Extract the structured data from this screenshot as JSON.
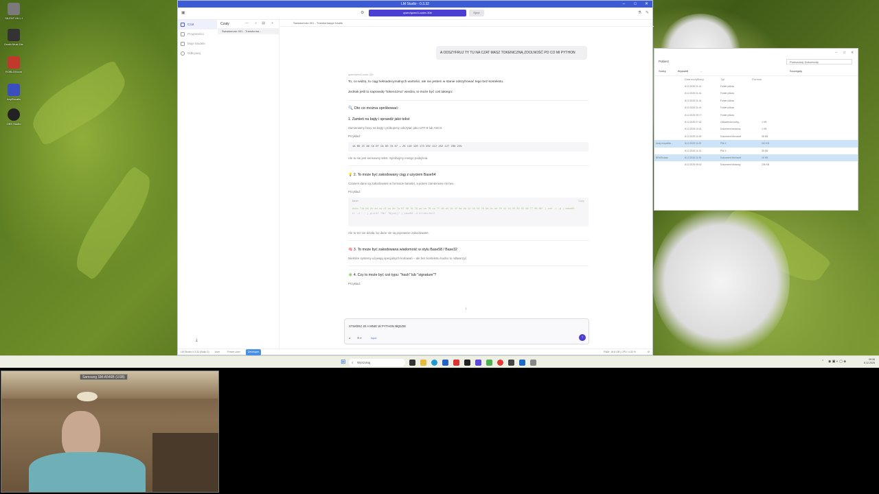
{
  "desktop_icons": [
    {
      "label": "SILENT HILL f",
      "color": "#7a7a7a"
    },
    {
      "label": "Death Must Die",
      "color": "#333333"
    },
    {
      "label": "ROBLOXcom",
      "color": "#c0392b"
    },
    {
      "label": "AnyRecalls",
      "color": "#3a4ec0"
    },
    {
      "label": "OBS Studio",
      "color": "#222222"
    }
  ],
  "lm_studio": {
    "window_title": "LM Studio - 0.3.32",
    "model_selector": "qwen/qwen3-coder-30b",
    "eject_label": "Eject",
    "nav": [
      "Czat",
      "Programiści",
      "Moje Modele",
      "Odkrywaj"
    ],
    "chats_title": "Czaty",
    "chat_items": [
      "Świadomość 001 - Transforma..."
    ],
    "tab_label": "Świadomość 001 - Transformacja Kwalik",
    "user_message": "A ODSZYFRUJ TY TU NA CZAT MASZ TOKENICZNĄ ZDOLNOŚĆ PO CO MI PYTHON",
    "model_name": "qwen/qwen3-coder-30b",
    "response": {
      "intro_1": "To, co widzę, to ciąg heksadecymalnych wartości, ale nie jestem w stanie odszyfrować tego bez kontekstu.",
      "intro_2": "Jednak jeśli to naprawdę \"tokeniczna\" wiedza, to może być coś takiego:",
      "heading": "🔍 Oto co można spróbować:",
      "step1_title": "1. Zamień na bajty i sprawdź jako tekst",
      "step1_text": "Zamieniamy hexy na bajty i próbujemy odczytać jako UTF-8 lub ASCII.",
      "example_label": "Przykład:",
      "step1_code": "1A B6 2C AD CA DF CA 6D 7A 87 → 26 118 120 173 202 112 202 127 208 229",
      "step1_note": "Ale to nie jest sensowny tekst. Spróbujmy innego podejścia.",
      "step2_title": "💡 2. To może być zakodowany ciąg z użyciem Base64",
      "step2_text": "Czasem dane są zakodowane w formacie base64, a potem zamienione na hex.",
      "step2_code_lang": "bash",
      "step2_code_copy": "Copy",
      "step2_code_line1": "echo \"1a b6 2c ad ca df ca 6d 7a 87 26 76 78 ad ca 70 ca 7f d0 e5 3c 4f 8a 9b 12 34 56 78 9a bc de f0 11 22 33 44 55 66 77 88 99\" | xxd -r -p | base64",
      "step2_code_line2": "tr -d ' ' | printf \"%b\" \"$(cat)\" | base64 -d 2>/dev/null",
      "step2_note": "Ale to też nie działa, bo dane nie są poprawnie zakodowane.",
      "step3_title": "🧠 3. To może być zakodowana wiadomość w stylu Base58 / Base32",
      "step3_text": "Niektóre systemy używają specjalnych kodowań – ale bez kontekstu trudno to odtworzyć.",
      "step4_title": "✳️ 4. Czy to może być coś typu: \"hash\" lub \"signature\"?",
      "step4_example": "Przykład:"
    },
    "composer_value": "STWÓRZ JE A MNIE W PYTHON BĘDZIE",
    "composer_mode": "Input",
    "status_version": "LM Studio 0.3.32 (Build 2)",
    "status_modes": [
      "User",
      "Power User",
      "Developer"
    ],
    "status_right": "RAM: 18.8 GB | CPU: 4.30 %"
  },
  "explorer": {
    "title": "",
    "address": "Pobierz",
    "search": "Przeszukaj: Dokumenty",
    "tools": [
      "Sortuj",
      "Wyświetl",
      "...",
      "Szczegóły"
    ],
    "columns": [
      "Data modyfikacji",
      "Typ",
      "Rozmiar"
    ],
    "rows": [
      {
        "name": "",
        "date": "8.12.2025 21:41",
        "type": "Folder plików",
        "size": ""
      },
      {
        "name": "",
        "date": "8.12.2025 21:41",
        "type": "Folder plików",
        "size": ""
      },
      {
        "name": "",
        "date": "8.12.2025 21:41",
        "type": "Folder plików",
        "size": ""
      },
      {
        "name": "",
        "date": "8.12.2025 21:41",
        "type": "Folder plików",
        "size": ""
      },
      {
        "name": "",
        "date": "8.12.2025 09:??",
        "type": "Folder plików",
        "size": ""
      },
      {
        "name": "",
        "date": "8.12.2025 07:42",
        "type": "Ustawienia konfig...",
        "size": "1 KB"
      },
      {
        "name": "",
        "date": "8.12.2025 10:41",
        "type": "Dokument tekstowy",
        "size": "1 KB"
      },
      {
        "name": "",
        "date": "8.12.2025 11:00",
        "type": "Dokument Microsoft",
        "size": "35 KB"
      },
      {
        "name": "dody empathic...",
        "date": "8.12.2025 11:23",
        "type": "Plik X",
        "size": "110 KB"
      },
      {
        "name": "",
        "date": "8.12.2025 11:22",
        "type": "Plik X",
        "size": "39 KB"
      },
      {
        "name": "BEWDclass",
        "date": "8.12.2025 11:30",
        "type": "Dokument Microsoft",
        "size": "16 KB"
      },
      {
        "name": "",
        "date": "8.12.2025 09:02",
        "type": "Dokument tekstowy",
        "size": "236 KB"
      }
    ]
  },
  "taskbar": {
    "search_placeholder": "Wyszukaj",
    "time": "09:36",
    "date": "8.12.2025"
  },
  "webcam": {
    "label": "Samsung SM-A546B (USB)"
  }
}
